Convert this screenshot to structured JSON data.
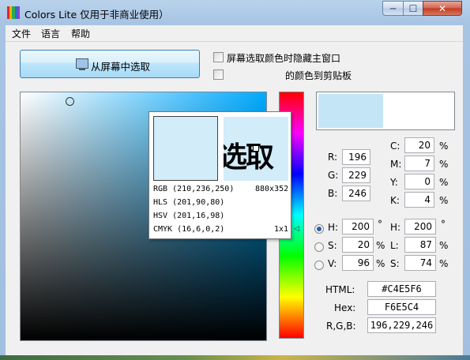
{
  "window": {
    "title": "Colors Lite 仅用于非商业使用）"
  },
  "caption_buttons": {
    "minimize": "─",
    "maximize": "☐",
    "close": "✕"
  },
  "menu": {
    "file": "文件",
    "language": "语言",
    "help": "帮助"
  },
  "pick_button": {
    "label": "从屏幕中选取",
    "icon": "monitor-icon"
  },
  "options": {
    "hide_window": {
      "label": "屏幕选取颜色时隐藏主窗口",
      "checked": false
    },
    "copy_clipboard": {
      "label": "的颜色到剪贴板",
      "checked": false
    }
  },
  "gradient_field": {
    "color": "#00aaff"
  },
  "hue_bar": {
    "arrow_left": "▷",
    "arrow_right": "◁"
  },
  "preview": {
    "selected_color": "#C4E5F6"
  },
  "rgb": {
    "r_label": "R:",
    "r": "196",
    "g_label": "G:",
    "g": "229",
    "b_label": "B:",
    "b": "246"
  },
  "cmyk": {
    "c_label": "C:",
    "c": "20",
    "m_label": "M:",
    "m": "7",
    "y_label": "Y:",
    "y": "0",
    "k_label": "K:",
    "k": "4",
    "unit": "%"
  },
  "hsv": {
    "h_label": "H:",
    "h": "200",
    "h_unit": "°",
    "s_label": "S:",
    "s": "20",
    "s_unit": "%",
    "v_label": "V:",
    "v": "96",
    "v_unit": "%",
    "selected": "H"
  },
  "hls": {
    "h_label": "H:",
    "h": "200",
    "h_unit": "°",
    "l_label": "L:",
    "l": "87",
    "l_unit": "%",
    "s_label": "S:",
    "s": "74",
    "s_unit": "%"
  },
  "codes": {
    "html_label": "HTML:",
    "html": "#C4E5F6",
    "hex_label": "Hex:",
    "hex": "F6E5C4",
    "rgb_label": "R,G,B:",
    "rgb": "196,229,246"
  },
  "popup": {
    "swatch_color": "#D2ECFA",
    "zoom_text": "选取",
    "rgb": "RGB (210,236,250)",
    "hls": "HLS (201,90,80)",
    "hsv": "HSV (201,16,98)",
    "cmyk": "CMYK (16,6,0,2)",
    "resolution": "880x352",
    "zoom_level": "1x1"
  }
}
